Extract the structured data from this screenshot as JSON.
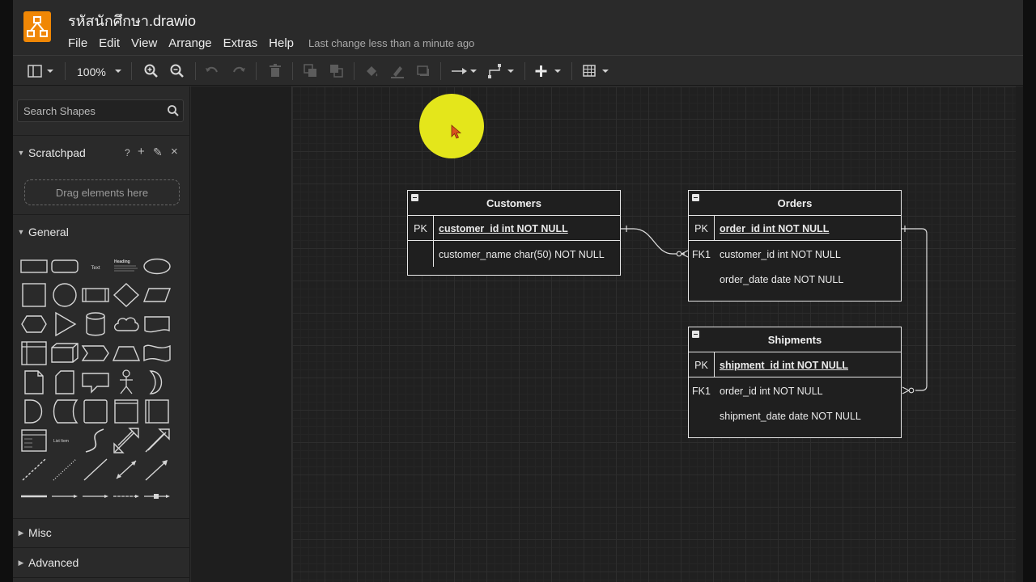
{
  "app": {
    "title": "รหัสนักศึกษา.drawio",
    "last_change": "Last change less than a minute ago",
    "menu": [
      "File",
      "Edit",
      "View",
      "Arrange",
      "Extras",
      "Help"
    ]
  },
  "toolbar": {
    "zoom": "100%",
    "icons": [
      "format-panel-icon",
      "zoom-in-icon",
      "zoom-out-icon",
      "undo-icon",
      "redo-icon",
      "delete-icon",
      "to-front-icon",
      "to-back-icon",
      "fill-color-icon",
      "line-color-icon",
      "shadow-icon",
      "connection-icon",
      "waypoints-icon",
      "insert-icon",
      "table-icon"
    ]
  },
  "sidebar": {
    "search_placeholder": "Search Shapes",
    "scratchpad": {
      "label": "Scratchpad",
      "drag_hint": "Drag elements here",
      "tools": [
        "?",
        "+",
        "✎",
        "×"
      ]
    },
    "sections": {
      "general": "General",
      "misc": "Misc",
      "advanced": "Advanced"
    },
    "shape_text": {
      "text": "Text",
      "heading": "Heading",
      "list_item": "List Item"
    }
  },
  "diagram": {
    "tables": [
      {
        "name": "Customers",
        "rows": [
          {
            "key": "PK",
            "field": "customer_id int NOT NULL",
            "primary": true
          },
          {
            "key": "",
            "field": "customer_name char(50) NOT NULL",
            "primary": false
          }
        ]
      },
      {
        "name": "Orders",
        "rows": [
          {
            "key": "PK",
            "field": "order_id int NOT NULL",
            "primary": true
          },
          {
            "key": "FK1",
            "field": "customer_id int NOT NULL",
            "primary": false
          },
          {
            "key": "",
            "field": "order_date date NOT NULL",
            "primary": false
          }
        ]
      },
      {
        "name": "Shipments",
        "rows": [
          {
            "key": "PK",
            "field": "shipment_id int NOT NULL",
            "primary": true
          },
          {
            "key": "FK1",
            "field": "order_id int NOT NULL",
            "primary": false
          },
          {
            "key": "",
            "field": "shipment_date date NOT NULL",
            "primary": false
          }
        ]
      }
    ],
    "relations": [
      {
        "from": "Customers.customer_id",
        "to": "Orders.customer_id",
        "type": "one-to-many"
      },
      {
        "from": "Orders.order_id",
        "to": "Shipments.order_id",
        "type": "one-to-many"
      }
    ]
  },
  "colors": {
    "accent": "#f08705",
    "highlight": "#e4e61b",
    "entity_stroke": "#e6e6e6"
  }
}
